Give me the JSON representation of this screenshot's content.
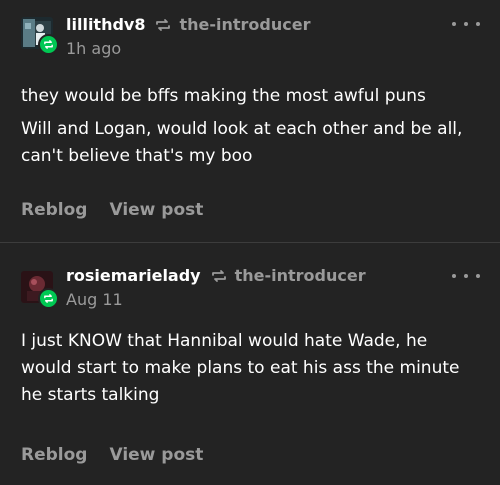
{
  "posts": [
    {
      "username": "lillithdv8",
      "source": "the-introducer",
      "time": "1h ago",
      "paragraphs": [
        "they would be bffs making the most awful puns",
        "Will and Logan, would look at each other and be all, can't believe that's my boo"
      ],
      "actions": {
        "reblog": "Reblog",
        "view": "View post"
      }
    },
    {
      "username": "rosiemarielady",
      "source": "the-introducer",
      "time": "Aug 11",
      "paragraphs": [
        "I just KNOW that Hannibal would hate Wade, he would start to make plans to eat his ass the minute he starts talking"
      ],
      "actions": {
        "reblog": "Reblog",
        "view": "View post"
      }
    }
  ],
  "colors": {
    "background": "#232323",
    "muted": "#9a9a9a",
    "reblog_badge": "#00c853"
  },
  "icons": {
    "reblog": "reblog-icon",
    "more": "more-options-icon"
  }
}
